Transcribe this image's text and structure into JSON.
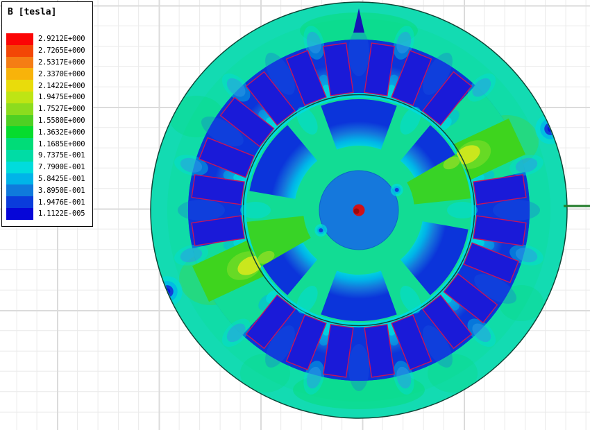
{
  "legend": {
    "title": "B [tesla]",
    "bands": [
      {
        "value": "2.9212E+000",
        "color": "#FB0505"
      },
      {
        "value": "2.7265E+000",
        "color": "#F34606"
      },
      {
        "value": "2.5317E+000",
        "color": "#F57D14"
      },
      {
        "value": "2.3370E+000",
        "color": "#F8B30A"
      },
      {
        "value": "2.1422E+000",
        "color": "#E9DC0B"
      },
      {
        "value": "1.9475E+000",
        "color": "#BEE514"
      },
      {
        "value": "1.7527E+000",
        "color": "#8CDC1E"
      },
      {
        "value": "1.5580E+000",
        "color": "#4FD023"
      },
      {
        "value": "1.3632E+000",
        "color": "#06DC2D"
      },
      {
        "value": "1.1685E+000",
        "color": "#00DC78"
      },
      {
        "value": "9.7375E-001",
        "color": "#00DCA5"
      },
      {
        "value": "7.7900E-001",
        "color": "#00DCDC"
      },
      {
        "value": "5.8425E-001",
        "color": "#00B4E8"
      },
      {
        "value": "3.8950E-001",
        "color": "#0F7ADC"
      },
      {
        "value": "1.9476E-001",
        "color": "#0A3CDC"
      },
      {
        "value": "1.1122E-005",
        "color": "#0606D8"
      }
    ]
  },
  "plot": {
    "field_colors": {
      "outer_region_teal": "#10DCA8",
      "rim_tint_cyan": "#1BDCC9",
      "rotor_ring_teal": "#12DC94",
      "stator_blue": "#0B34DA",
      "coil_fill": "#1A1AD8",
      "coil_outline": "#C6145A",
      "saturation_green": "#3ED41E",
      "green_blob": "#0ADC7E",
      "hotspot_yellow": "#DCE91C",
      "cyan": "#00DCDC",
      "sky_blue": "#00B4E8",
      "mid_blue": "#1578DC",
      "shaft_blue": "#1578DC",
      "center_dot_red": "#D11117",
      "marker_navy": "#1414B4",
      "axis_line_green": "#1F7A28",
      "boundary_line": "#0F4538"
    },
    "grid_colors": {
      "minor": "#EAEAEA",
      "major": "#DBDBDB"
    }
  }
}
